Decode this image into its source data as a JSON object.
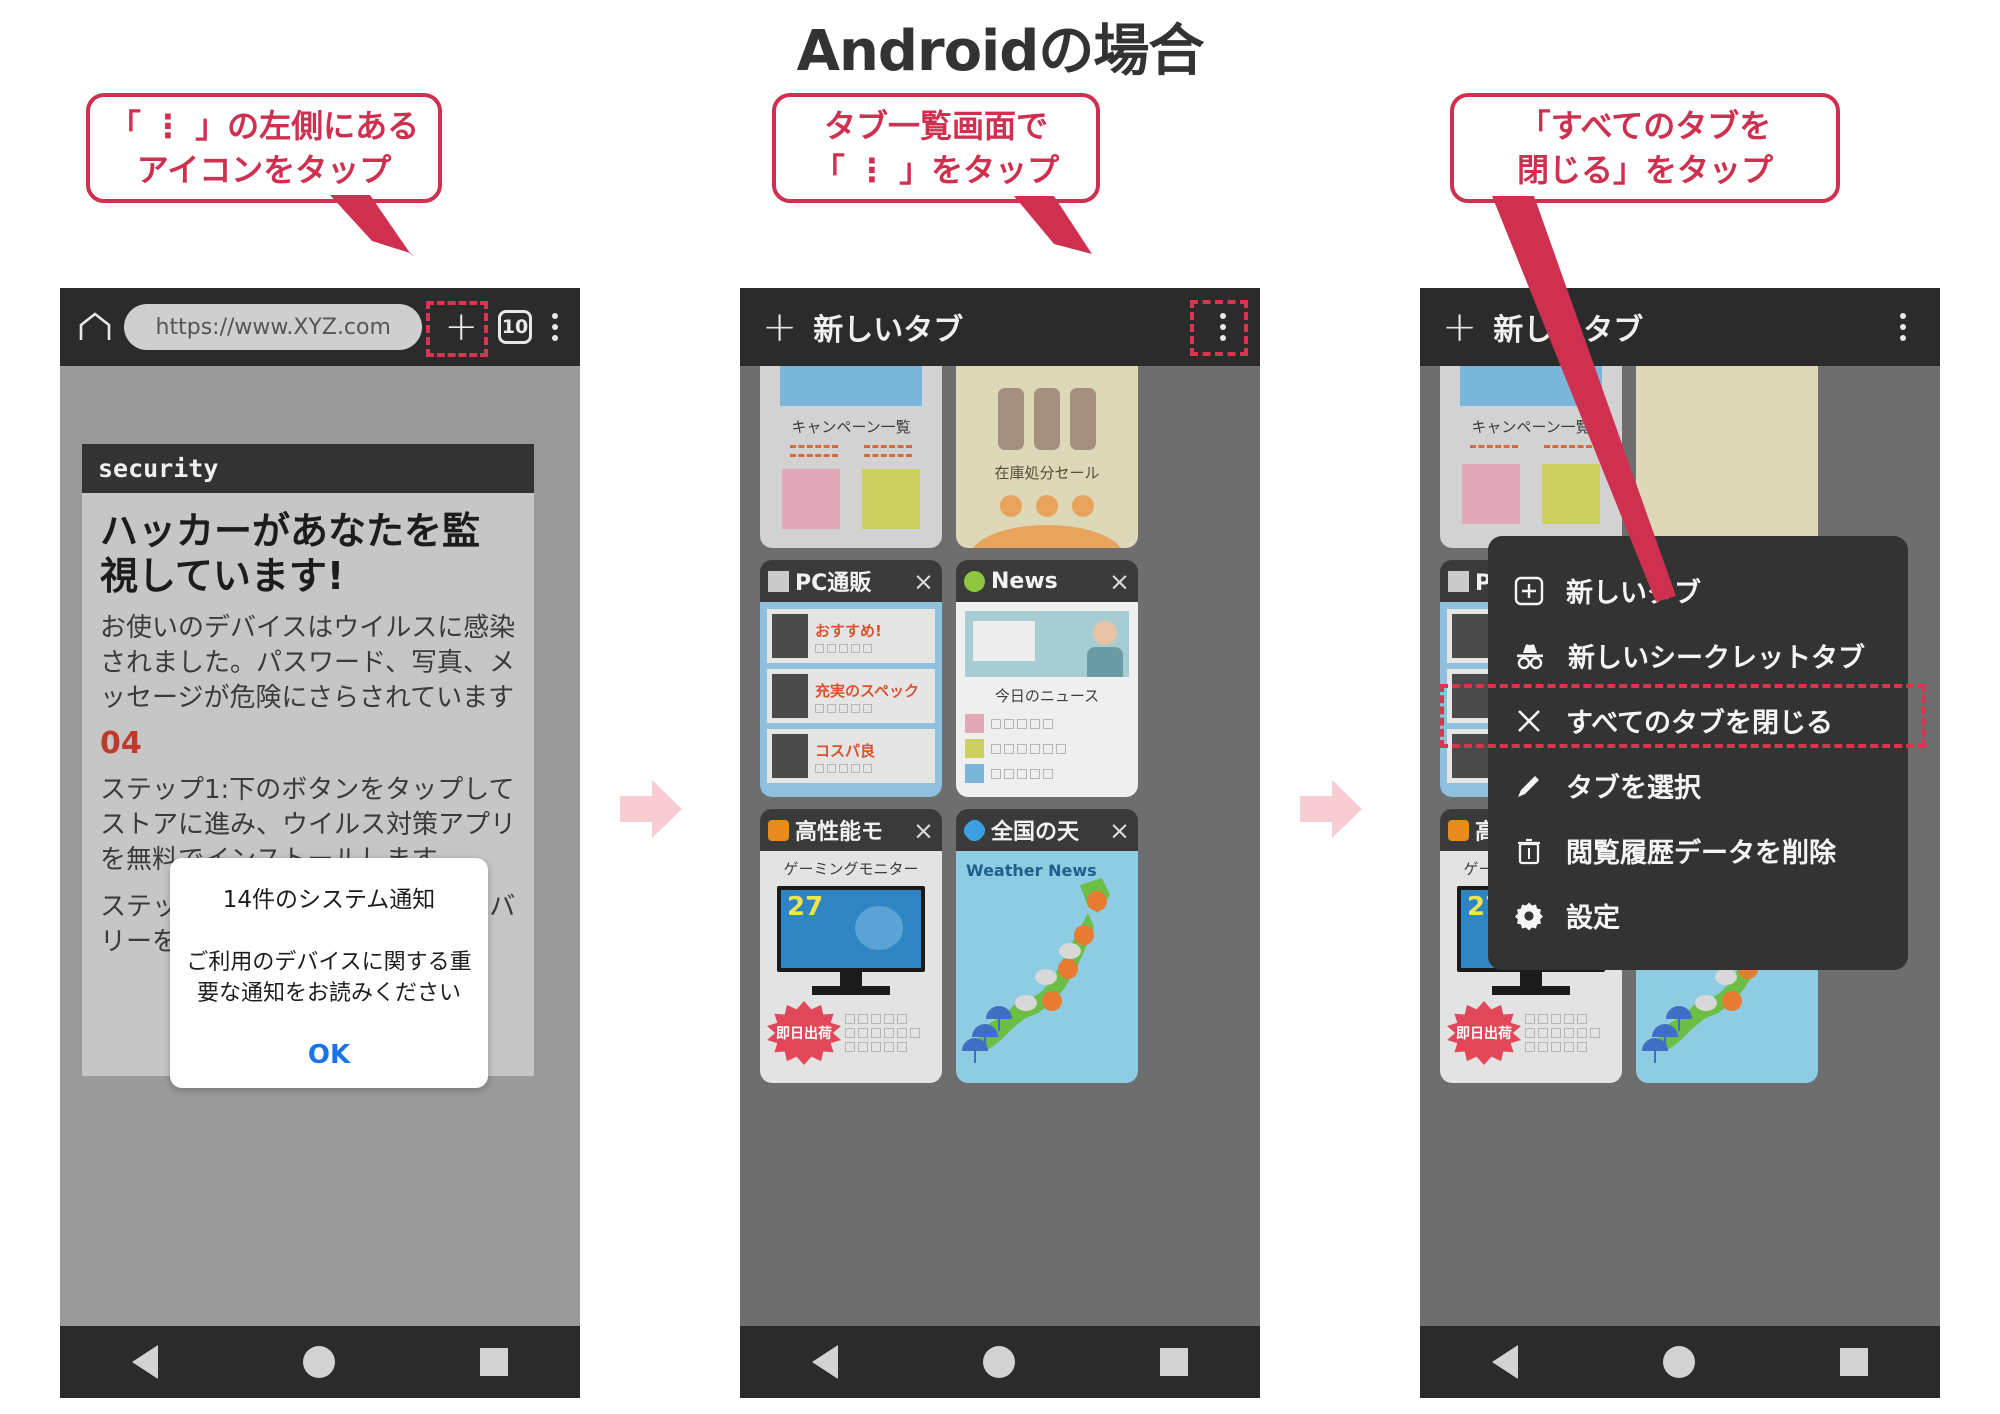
{
  "page": {
    "title": "Androidの場合",
    "accent_red": "#cf3050",
    "dash_red": "#d8354f",
    "pink_arrow": "#f7ccd3"
  },
  "callouts": [
    {
      "name": "callout-1",
      "lines": [
        "「 ⋮ 」の左側にある",
        "アイコンをタップ"
      ]
    },
    {
      "name": "callout-2",
      "lines": [
        "タブ一覧画面で",
        "「 ⋮ 」をタップ"
      ]
    },
    {
      "name": "callout-3",
      "lines": [
        "「すべてのタブを",
        "閉じる」をタップ"
      ]
    }
  ],
  "phone1": {
    "browser": {
      "home_icon": "home-icon",
      "url": "https://www.XYZ.com",
      "new_tab_icon": "plus-icon",
      "tab_count": "10",
      "menu_icon": "kebab-menu-icon"
    },
    "site": {
      "header": "security",
      "heading": "ハッカーがあなたを監視しています!",
      "body1": "お使いのデバイスはウイルスに感染されました。パスワード、写真、メッセージが危険にさらされています",
      "number": "04",
      "body2": "ステップ1:下のボタンをタップしてストアに進み、ウイルス対策アプリを無料でインストールします",
      "body3": "ステップ2:アプリを実行し、リカバリーを行います"
    },
    "dialog": {
      "title": "14件のシステム通知",
      "body": "ご利用のデバイスに関する重要な通知をお読みください",
      "ok": "OK"
    }
  },
  "phone2": {
    "header": {
      "new_tab_icon": "plus-icon",
      "label": "新しいタブ",
      "menu_icon": "kebab-menu-icon"
    },
    "tabs": [
      {
        "title": "",
        "favicon": "",
        "content_label": "キャンペーン一覧"
      },
      {
        "title": "",
        "favicon": "",
        "content_label": "在庫処分セール"
      },
      {
        "title": "PC通販",
        "favicon": "square-gray",
        "close": "×",
        "items": [
          "おすすめ!",
          "充実のスペック",
          "コスパ良"
        ]
      },
      {
        "title": "News",
        "favicon": "circle-green",
        "close": "×",
        "content_label": "今日のニュース"
      },
      {
        "title": "高性能モ",
        "favicon": "square-orange",
        "close": "×",
        "content_label": "ゲーミングモニター",
        "monitor_value": "27",
        "badge": "即日出荷"
      },
      {
        "title": "全国の天",
        "favicon": "diamond-blue",
        "close": "×",
        "content_label": "Weather News"
      }
    ]
  },
  "phone3": {
    "header": {
      "new_tab_icon": "plus-icon",
      "label": "新しいタブ",
      "menu_icon": "kebab-menu-icon"
    },
    "menu": [
      {
        "icon": "new-tab-icon",
        "label": "新しいタブ",
        "highlighted": false
      },
      {
        "icon": "incognito-icon",
        "label": "新しいシークレットタブ",
        "highlighted": false
      },
      {
        "icon": "close-icon",
        "label": "すべてのタブを閉じる",
        "highlighted": true
      },
      {
        "icon": "pencil-icon",
        "label": "タブを選択",
        "highlighted": false
      },
      {
        "icon": "trash-icon",
        "label": "閲覧履歴データを削除",
        "highlighted": false
      },
      {
        "icon": "gear-icon",
        "label": "設定",
        "highlighted": false
      }
    ]
  },
  "navbar": {
    "back": "back-triangle-icon",
    "home": "home-circle-icon",
    "recents": "recents-square-icon"
  }
}
